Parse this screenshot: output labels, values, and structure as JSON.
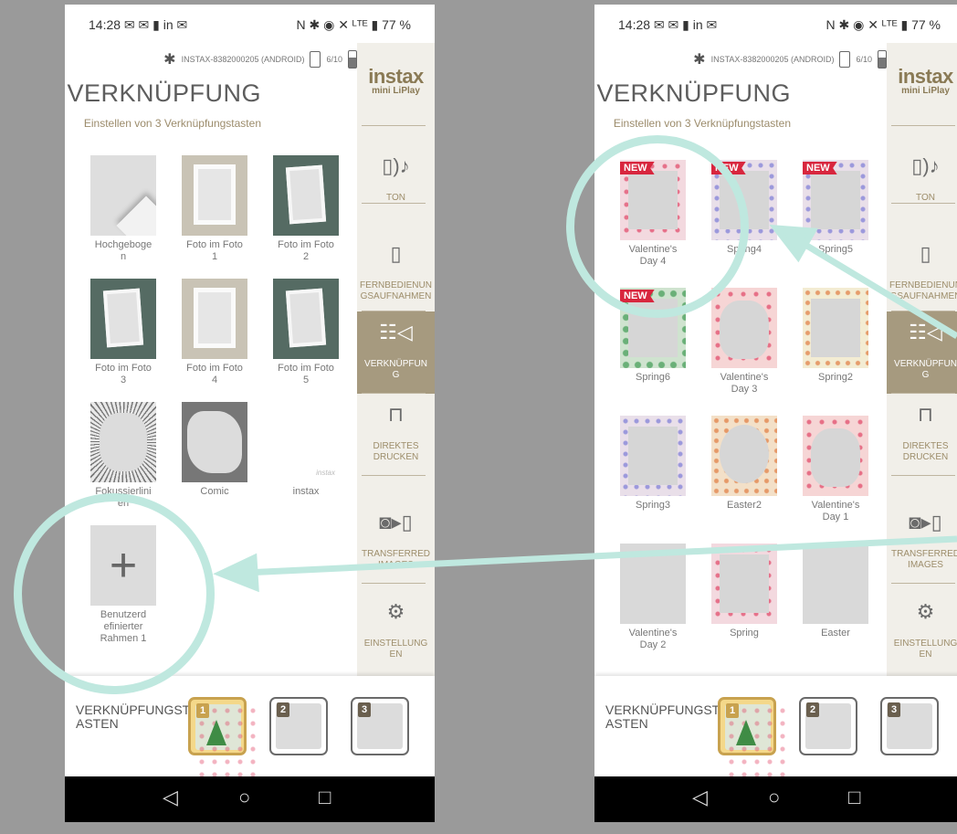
{
  "status_bar": {
    "time_icons": "14:28 ✉ ✉ ▮ in ✉",
    "right_icons": "N ✱ ◉ ✕ ᴸᵀᴱ ▮ 77 %"
  },
  "device": {
    "name": "INSTAX-8382000205 (ANDROID)",
    "count": "6/10"
  },
  "header": {
    "title": "VERKNÜPFUNG",
    "subtitle": "Einstellen von 3 Verknüpfungstasten"
  },
  "logo": {
    "line1": "instax",
    "line2": "mini LiPlay"
  },
  "sidebar": [
    {
      "label": "TON",
      "icon": "speaker-icon",
      "glyph": "▯)♪"
    },
    {
      "label": "FERNBEDIENUNGSAUFNAHMEN",
      "label_display": "FERNBEDIENUN\nGSAUFNAHMEN",
      "icon": "remote-icon",
      "glyph": "▯"
    },
    {
      "label": "VERKNÜPFUNG",
      "label_display": "VERKNÜPFUN\nG",
      "icon": "shortcut-icon",
      "glyph": "☷◁"
    },
    {
      "label": "DIREKTES DRUCKEN",
      "label_display": "DIREKTES\nDRUCKEN",
      "icon": "print-icon",
      "glyph": "⊓"
    },
    {
      "label": "TRANSFERRED IMAGES",
      "label_display": "TRANSFERRED\nIMAGES",
      "icon": "transfer-icon",
      "glyph": "◙▸▯"
    },
    {
      "label": "EINSTELLUNGEN",
      "label_display": "EINSTELLUNG\nEN",
      "icon": "settings-icon",
      "glyph": "⚙"
    }
  ],
  "left_frames": [
    {
      "caption": "Hochgeboge\nn",
      "style": "curl"
    },
    {
      "caption": "Foto im Foto\n1",
      "style": "light"
    },
    {
      "caption": "Foto im Foto\n2",
      "style": "dark"
    },
    {
      "caption": "Foto im Foto\n3",
      "style": "dark"
    },
    {
      "caption": "Foto im Foto\n4",
      "style": "light"
    },
    {
      "caption": "Foto im Foto\n5",
      "style": "dark"
    },
    {
      "caption": "Fokussierlini\nen",
      "style": "burst"
    },
    {
      "caption": "Comic",
      "style": "comic"
    },
    {
      "caption": "instax",
      "style": "instax",
      "watermark": "instax"
    },
    {
      "caption": "Benutzerd\nefinierter\nRahmen 1",
      "style": "plus",
      "glyph": "+"
    }
  ],
  "right_frames": [
    {
      "caption": "Valentine's\nDay 4",
      "badge": "NEW",
      "style": "pink"
    },
    {
      "caption": "Spring4",
      "badge": "NEW",
      "style": "flower"
    },
    {
      "caption": "Spring5",
      "badge": "NEW",
      "style": "flower"
    },
    {
      "caption": "Spring6",
      "badge": "NEW",
      "style": "green"
    },
    {
      "caption": "Valentine's\nDay 3",
      "style": "red"
    },
    {
      "caption": "Spring2",
      "style": "yellow"
    },
    {
      "caption": "Spring3",
      "style": "flower"
    },
    {
      "caption": "Easter2",
      "style": "orange"
    },
    {
      "caption": "Valentine's\nDay 1",
      "style": "red"
    },
    {
      "caption": "Valentine's\nDay 2",
      "style": "plain"
    },
    {
      "caption": "Spring",
      "style": "pink"
    },
    {
      "caption": "Easter",
      "style": "plain"
    }
  ],
  "shortcut_bar": {
    "label": "VERKNÜPFUNGST\nASTEN",
    "slots": [
      "1",
      "2",
      "3"
    ]
  },
  "nav": {
    "back": "◁",
    "home": "○",
    "recent": "□"
  }
}
